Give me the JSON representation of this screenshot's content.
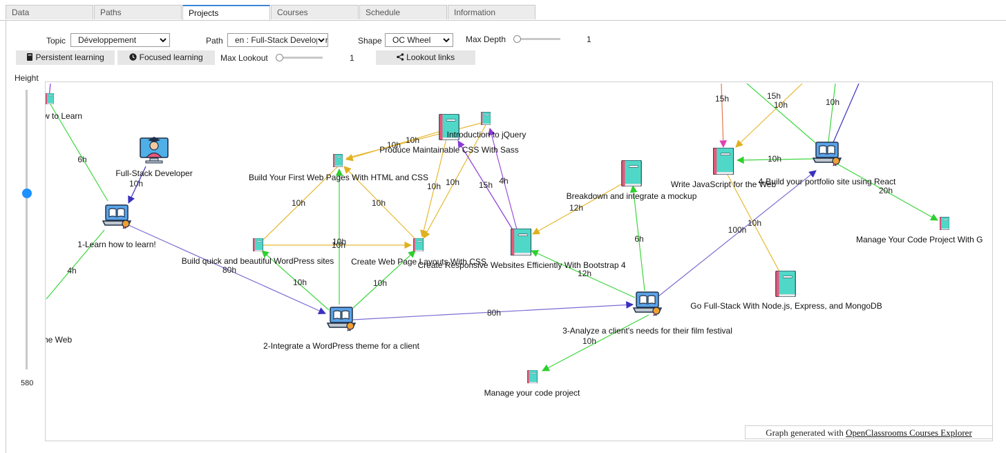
{
  "tabs": [
    {
      "label": "Data",
      "active": false
    },
    {
      "label": "Paths",
      "active": false
    },
    {
      "label": "Projects",
      "active": true
    },
    {
      "label": "Courses",
      "active": false
    },
    {
      "label": "Schedule",
      "active": false
    },
    {
      "label": "Information",
      "active": false
    }
  ],
  "controls": {
    "topic_label": "Topic",
    "topic_value": "Développement",
    "path_label": "Path",
    "path_value": "en : Full-Stack Developer",
    "shape_label": "Shape",
    "shape_value": "OC Wheel",
    "max_depth_label": "Max Depth",
    "max_depth_value": "1",
    "max_lookout_label": "Max Lookout",
    "max_lookout_value": "1",
    "persistent_btn": "Persistent learning",
    "focused_btn": "Focused learning",
    "lookout_btn": "Lookout links",
    "height_label": "Height",
    "height_value": "580",
    "height_fraction": 0.63
  },
  "icons": {
    "book": "book-icon",
    "clock": "clock-icon",
    "share": "share-icon",
    "chevron": "chevron-down-icon",
    "laptop": "laptop-certificate-icon",
    "developer": "developer-avatar-icon"
  },
  "graph": {
    "colors": {
      "green": "#3dd63d",
      "gold": "#e6b830",
      "purple": "#8a3ad6",
      "navy": "#6a5acd",
      "navy_arrow": "#3b2fbf",
      "magenta": "#e040b0",
      "violet": "#9a4fd6",
      "book_teal": "#4fd8c8",
      "book_pink": "#e8577a"
    },
    "nodes": {
      "learn_cut": "w to Learn",
      "fullstack": "Full-Stack Developer",
      "p1": "1-Learn how to learn!",
      "web_cut": "he Web",
      "first_pages": "Build Your First Web Pages With HTML and CSS",
      "jquery": "Introduction to jQuery",
      "sass": "Produce Maintainable CSS With Sass",
      "wordpress_sites": "Build quick and beautiful WordPress sites",
      "layouts": "Create Web Page Layouts With CSS",
      "bootstrap": "Create Responsive Websites Efficiently With Bootstrap 4",
      "breakdown": "Breakdown and integrate a mockup",
      "p2": "2-Integrate a WordPress theme for a client",
      "p3": "3-Analyze a client's needs for their film festival",
      "manage_lower": "Manage your code project",
      "js": "Write JavaScript for the Web",
      "p4": "4-Build your portfolio site using React",
      "manage_upper": "Manage Your Code Project With G",
      "node": "Go Full-Stack With Node.js, Express, and MongoDB"
    },
    "edges": [
      {
        "label": "6h"
      },
      {
        "label": "10h"
      },
      {
        "label": "80h"
      },
      {
        "label": "4h"
      },
      {
        "label": "10h"
      },
      {
        "label": "10h"
      },
      {
        "label": "10h"
      },
      {
        "label": "10h"
      },
      {
        "label": "10h"
      },
      {
        "label": "10h"
      },
      {
        "label": "10h"
      },
      {
        "label": "10h"
      },
      {
        "label": "10h"
      },
      {
        "label": "15h"
      },
      {
        "label": "4h"
      },
      {
        "label": "10h"
      },
      {
        "label": "80h"
      },
      {
        "label": "12h"
      },
      {
        "label": "12h"
      },
      {
        "label": "6h"
      },
      {
        "label": "10h"
      },
      {
        "label": "100h"
      },
      {
        "label": "10h"
      },
      {
        "label": "15h"
      },
      {
        "label": "15h"
      },
      {
        "label": "10h"
      },
      {
        "label": "10h"
      },
      {
        "label": "10h"
      },
      {
        "label": "20h"
      }
    ]
  },
  "credit": {
    "prefix": "Graph generated with ",
    "link": "OpenClassrooms Courses Explorer"
  }
}
